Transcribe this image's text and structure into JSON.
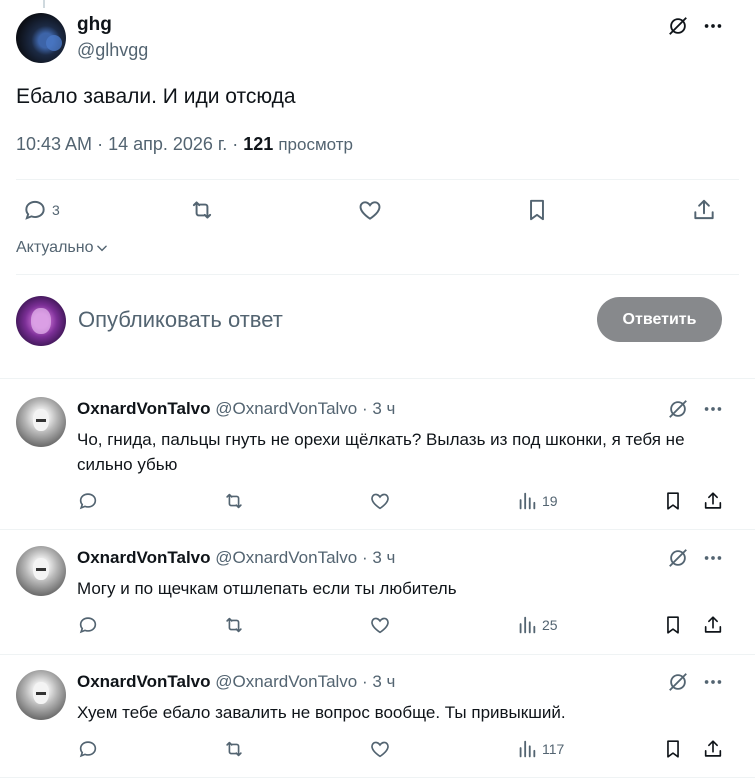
{
  "post": {
    "name": "ghg",
    "handle": "@glhvgg",
    "text": "Ебало завали. И иди отсюда",
    "time": "10:43 AM",
    "sep": " · ",
    "date": "14 апр. 2026 г.",
    "views_count": "121",
    "views_label": "просмотр",
    "replies_count": "3"
  },
  "sort": {
    "label": "Актуально"
  },
  "composer": {
    "placeholder": "Опубликовать ответ",
    "button": "Ответить"
  },
  "replies": [
    {
      "name": "OxnardVonTalvo",
      "handle": "@OxnardVonTalvo",
      "time": "· 3 ч",
      "text": "Чо, гнида, пальцы гнуть не орехи щёлкать? Вылазь из под шконки, я тебя не сильно убью",
      "views": "19"
    },
    {
      "name": "OxnardVonTalvo",
      "handle": "@OxnardVonTalvo",
      "time": "· 3 ч",
      "text": "Могу и по щечкам отшлепать если ты любитель",
      "views": "25"
    },
    {
      "name": "OxnardVonTalvo",
      "handle": "@OxnardVonTalvo",
      "time": "· 3 ч",
      "text": "Хуем тебе ебало завалить не вопрос вообще. Ты привыкший.",
      "views": "117"
    }
  ],
  "icons": {
    "reply": "reply-bubble-icon",
    "retweet": "retweet-icon",
    "like": "heart-icon",
    "views": "views-chart-icon",
    "bookmark": "bookmark-icon",
    "share": "share-icon",
    "grok": "grok-icon",
    "more": "more-dots-icon"
  },
  "colors": {
    "text": "#0f1419",
    "muted": "#536471",
    "divider": "#eff3f4",
    "reply_button": "#87898c"
  }
}
